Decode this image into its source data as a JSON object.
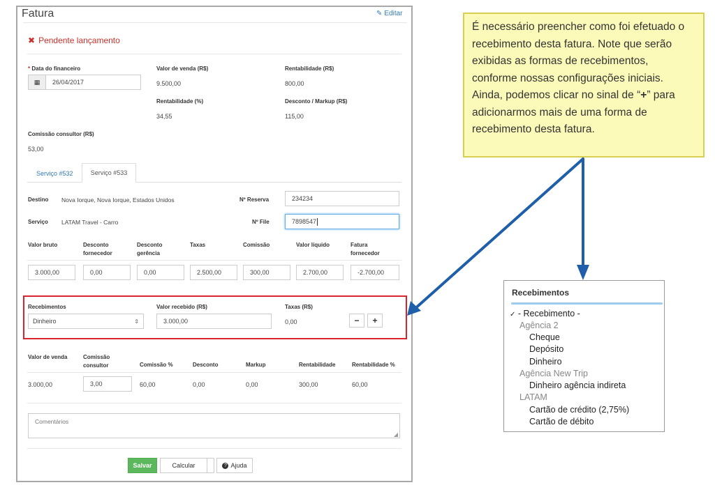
{
  "form": {
    "title": "Fatura",
    "edit_label": "Editar",
    "status": "Pendente lançamento",
    "finance_date_label": "Data do financeiro",
    "required_mark": "*",
    "finance_date_value": "26/04/2017",
    "sale_value_label": "Valor de venda (R$)",
    "sale_value": "9.500,00",
    "profit_label": "Rentabilidade (R$)",
    "profit_value": "800,00",
    "profit_pct_label": "Rentabilidade (%)",
    "profit_pct_value": "34,55",
    "discount_label": "Desconto / Markup (R$)",
    "discount_value": "115,00",
    "commission_label": "Comissão consultor (R$)",
    "commission_value": "53,00",
    "tabs": [
      "Serviço #532",
      "Serviço #533"
    ],
    "active_tab": "Serviço #533",
    "service": {
      "destination_label": "Destino",
      "destination_value": "Nova Iorque, Nova Iorque, Estados Unidos",
      "reservation_label": "Nº Reserva",
      "reservation_value": "234234",
      "service_label": "Serviço",
      "service_value": "LATAM Travel - Carro",
      "file_label": "Nº File",
      "file_value": "7898547"
    },
    "values_table": {
      "headers": [
        "Valor bruto",
        "Desconto fornecedor",
        "Desconto gerência",
        "Taxas",
        "Comissão",
        "Valor líquido",
        "Fatura fornecedor"
      ],
      "headers_line1": [
        "Valor bruto",
        "Desconto",
        "Desconto",
        "Taxas",
        "Comissão",
        "Valor líquido",
        "Fatura"
      ],
      "headers_line2": [
        "",
        "fornecedor",
        "gerência",
        "",
        "",
        "",
        "fornecedor"
      ],
      "values": [
        "3.000,00",
        "0,00",
        "0,00",
        "2.500,00",
        "300,00",
        "2.700,00",
        "-2.700,00"
      ]
    },
    "receipts": {
      "receipts_label": "Recebimentos",
      "receipts_value": "Dinheiro",
      "received_label": "Valor recebido (R$)",
      "received_value": "3.000,00",
      "fees_label": "Taxas (R$)",
      "fees_value": "0,00",
      "minus_label": "−",
      "plus_label": "+"
    },
    "summary_table": {
      "headers_line1": [
        "Valor de venda",
        "Comissão",
        "Comissão %",
        "Desconto",
        "Markup",
        "Rentabilidade",
        "Rentabilidade %"
      ],
      "headers_line2": [
        "",
        "consultor",
        "",
        "",
        "",
        "",
        ""
      ],
      "values": [
        "3.000,00",
        "3,00",
        "60,00",
        "0,00",
        "0,00",
        "300,00",
        "60,00"
      ]
    },
    "comments_placeholder": "Comentários",
    "buttons": {
      "save": "Salvar",
      "calc": "Calcular",
      "help": "Ajuda"
    }
  },
  "note": {
    "p1": "É necessário preencher como foi efetuado o recebimento desta fatura. Note que serão exibidas as formas de recebimentos, conforme nossas configurações iniciais.",
    "p2_a": "Ainda, podemos clicar no sinal de “",
    "p2_plus": "+",
    "p2_b": "” para adicionarmos mais de uma forma de recebimento desta fatura."
  },
  "dropdown": {
    "title": "Recebimentos",
    "check": "✓",
    "selected": "- Recebimento -",
    "groups": [
      {
        "label": "Agência 2",
        "items": [
          "Cheque",
          "Depósito",
          "Dinheiro"
        ]
      },
      {
        "label": "Agência New Trip",
        "items": [
          "Dinheiro agência indireta"
        ]
      },
      {
        "label": "LATAM",
        "items": [
          "Cartão de crédito (2,75%)",
          "Cartão de débito"
        ]
      }
    ]
  },
  "colors": {
    "highlight_border": "#d9232d",
    "arrow": "#1f5ea8",
    "save_green": "#5cb85c",
    "note_bg": "#fcfab8"
  }
}
